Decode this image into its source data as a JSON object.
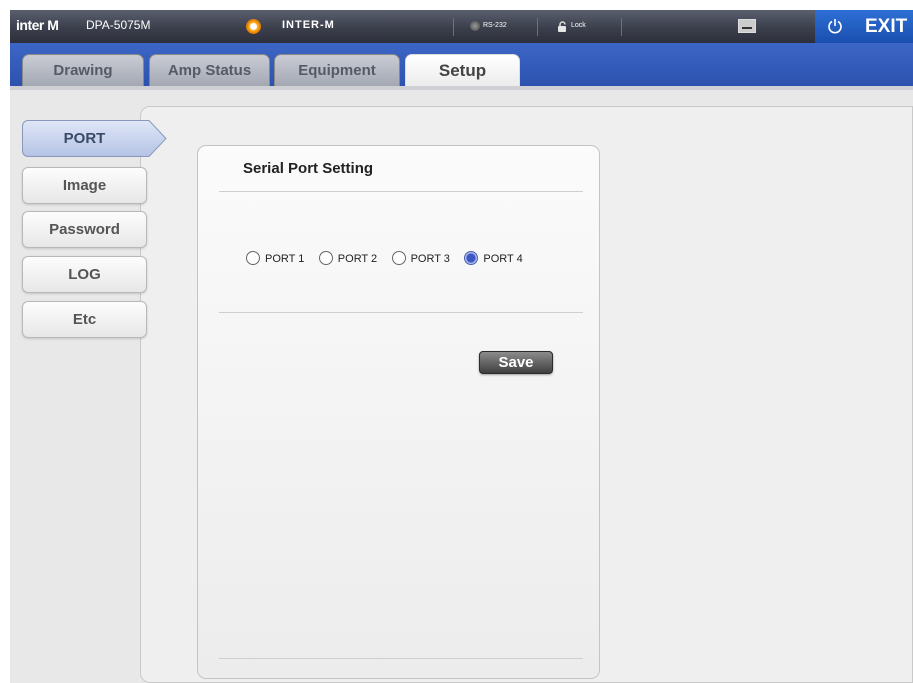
{
  "header": {
    "logo": "inter M",
    "model": "DPA-5075M",
    "device_name": "INTER-M",
    "rs232_label": "RS-232",
    "lock_label": "Lock",
    "exit_label": "EXIT",
    "accent": "#2c52ae"
  },
  "tabs": [
    {
      "label": "Drawing"
    },
    {
      "label": "Amp Status"
    },
    {
      "label": "Equipment"
    },
    {
      "label": "Setup",
      "active": true
    }
  ],
  "sidebar": {
    "items": [
      {
        "label": "PORT",
        "active": true
      },
      {
        "label": "Image"
      },
      {
        "label": "Password"
      },
      {
        "label": "LOG"
      },
      {
        "label": "Etc"
      }
    ]
  },
  "serial": {
    "title": "Serial Port Setting",
    "ports": [
      {
        "label": "PORT 1",
        "selected": false
      },
      {
        "label": "PORT 2",
        "selected": false
      },
      {
        "label": "PORT 3",
        "selected": false
      },
      {
        "label": "PORT 4",
        "selected": true
      }
    ],
    "save_label": "Save"
  }
}
